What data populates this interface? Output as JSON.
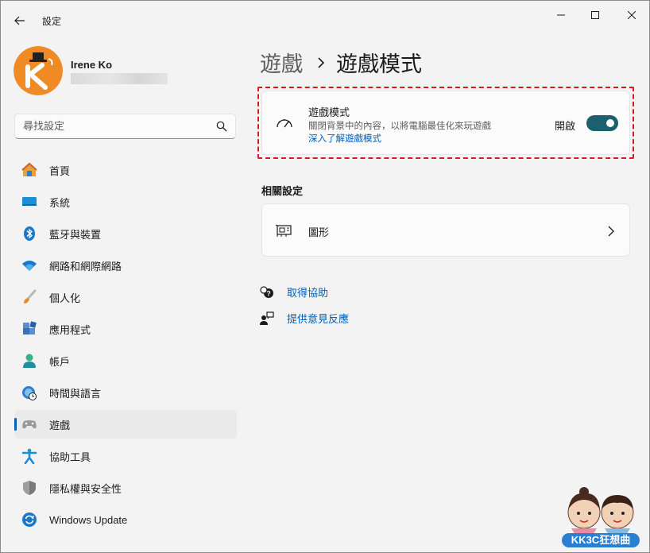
{
  "window": {
    "title": "設定",
    "controls": {
      "minimize_icon": "minimize-icon",
      "maximize_icon": "maximize-icon",
      "close_icon": "close-icon"
    }
  },
  "profile": {
    "name": "Irene Ko",
    "avatar_letter": "K"
  },
  "search": {
    "placeholder": "尋找設定",
    "value": ""
  },
  "sidebar": {
    "items": [
      {
        "label": "首頁",
        "icon": "home-icon",
        "active": false
      },
      {
        "label": "系統",
        "icon": "system-icon",
        "active": false
      },
      {
        "label": "藍牙與裝置",
        "icon": "bluetooth-icon",
        "active": false
      },
      {
        "label": "網路和網際網路",
        "icon": "wifi-icon",
        "active": false
      },
      {
        "label": "個人化",
        "icon": "brush-icon",
        "active": false
      },
      {
        "label": "應用程式",
        "icon": "apps-icon",
        "active": false
      },
      {
        "label": "帳戶",
        "icon": "account-icon",
        "active": false
      },
      {
        "label": "時間與語言",
        "icon": "globe-clock-icon",
        "active": false
      },
      {
        "label": "遊戲",
        "icon": "gamepad-icon",
        "active": true
      },
      {
        "label": "協助工具",
        "icon": "accessibility-icon",
        "active": false
      },
      {
        "label": "隱私權與安全性",
        "icon": "shield-icon",
        "active": false
      },
      {
        "label": "Windows Update",
        "icon": "update-icon",
        "active": false
      }
    ]
  },
  "breadcrumb": {
    "parent": "遊戲",
    "current": "遊戲模式"
  },
  "game_mode_card": {
    "title": "遊戲模式",
    "description": "關閉背景中的內容，以將電腦最佳化來玩遊戲",
    "link": "深入了解遊戲模式",
    "state_label": "開啟",
    "toggle_on": true
  },
  "related": {
    "title": "相關設定",
    "items": [
      {
        "label": "圖形",
        "icon": "graphics-card-icon"
      }
    ]
  },
  "help": {
    "get_help": "取得協助",
    "feedback": "提供意見反應"
  },
  "watermark": {
    "text": "KK3C狂想曲"
  },
  "colors": {
    "accent": "#005fb8",
    "toggle": "#1c5f6e",
    "highlight_border": "#d71920",
    "background": "#f3f3f3",
    "card": "#fbfbfb"
  }
}
